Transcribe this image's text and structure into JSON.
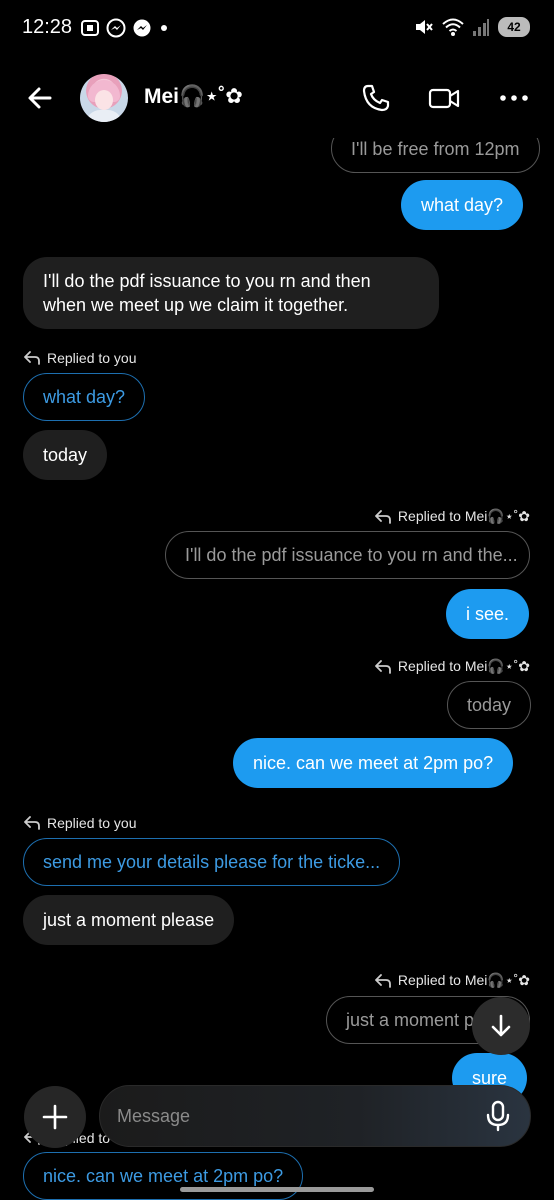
{
  "status_bar": {
    "time": "12:28",
    "battery": "42"
  },
  "header": {
    "contact_name": "Mei🎧⋆˚✿"
  },
  "messages": [
    {
      "id": "m1",
      "text": "I'll be free from 12pm"
    },
    {
      "id": "m2",
      "text": "what day?"
    },
    {
      "id": "m3",
      "text": "I'll do the pdf issuance to you rn and then"
    },
    {
      "id": "m3b",
      "text": "when we meet up we claim it together."
    },
    {
      "id": "m4_label",
      "text": "Replied to you"
    },
    {
      "id": "m4_quote",
      "text": "what day?"
    },
    {
      "id": "m4",
      "text": "today"
    },
    {
      "id": "m5_label",
      "text": "Replied to Mei🎧⋆˚✿"
    },
    {
      "id": "m5_quote",
      "text": "I'll do the pdf issuance to you rn and the..."
    },
    {
      "id": "m5",
      "text": "i see."
    },
    {
      "id": "m6_label",
      "text": "Replied to Mei🎧⋆˚✿"
    },
    {
      "id": "m6_quote",
      "text": "today"
    },
    {
      "id": "m6",
      "text": "nice. can we meet at 2pm po?"
    },
    {
      "id": "m7_label",
      "text": "Replied to you"
    },
    {
      "id": "m7_quote",
      "text": "send me your details please for the ticke..."
    },
    {
      "id": "m7",
      "text": "just a moment please"
    },
    {
      "id": "m8_label",
      "text": "Replied to Mei🎧⋆˚✿"
    },
    {
      "id": "m8_quote",
      "text": "just a moment pl"
    },
    {
      "id": "m8",
      "text": "sure"
    },
    {
      "id": "m9_label",
      "text": "Replied to"
    },
    {
      "id": "m9_quote",
      "text": "nice. can we meet at 2pm po?"
    }
  ],
  "composer": {
    "placeholder": "Message"
  },
  "colors": {
    "accent": "#1d9bf0",
    "incoming": "#1f1f1f",
    "background": "#000000"
  }
}
